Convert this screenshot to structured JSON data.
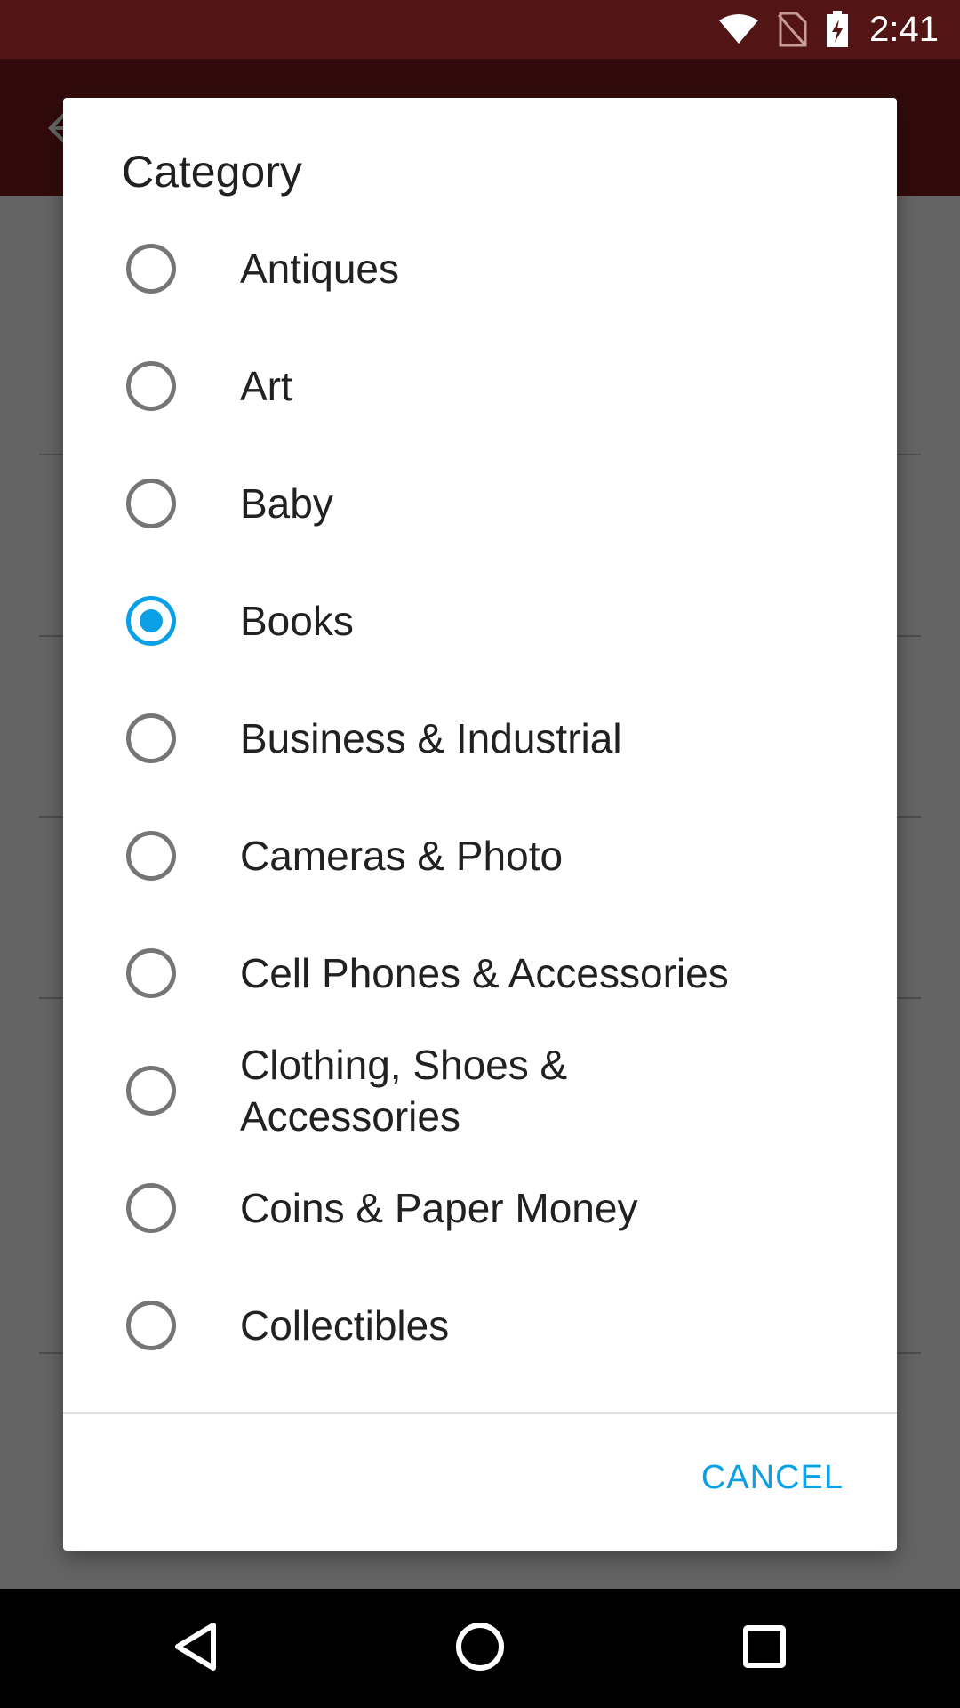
{
  "status_bar": {
    "time": "2:41",
    "icons": [
      "wifi-icon",
      "no-sim-icon",
      "battery-charging-icon"
    ]
  },
  "app_bar": {
    "icon": "back-arrow-icon"
  },
  "dialog": {
    "title": "Category",
    "options": [
      {
        "label": "Antiques",
        "selected": false
      },
      {
        "label": "Art",
        "selected": false
      },
      {
        "label": "Baby",
        "selected": false
      },
      {
        "label": "Books",
        "selected": true
      },
      {
        "label": "Business & Industrial",
        "selected": false
      },
      {
        "label": "Cameras & Photo",
        "selected": false
      },
      {
        "label": "Cell Phones & Accessories",
        "selected": false
      },
      {
        "label": "Clothing, Shoes & Accessories",
        "selected": false
      },
      {
        "label": "Coins & Paper Money",
        "selected": false
      },
      {
        "label": "Collectibles",
        "selected": false
      }
    ],
    "cancel_label": "CANCEL"
  },
  "nav_bar": {
    "icons": [
      "back-triangle-icon",
      "home-circle-icon",
      "recents-square-icon"
    ]
  },
  "colors": {
    "status_bar": "#521414",
    "app_bar": "#7a1c1c",
    "accent": "#0aa0e6",
    "radio_unchecked": "#757575",
    "text": "#212121"
  }
}
